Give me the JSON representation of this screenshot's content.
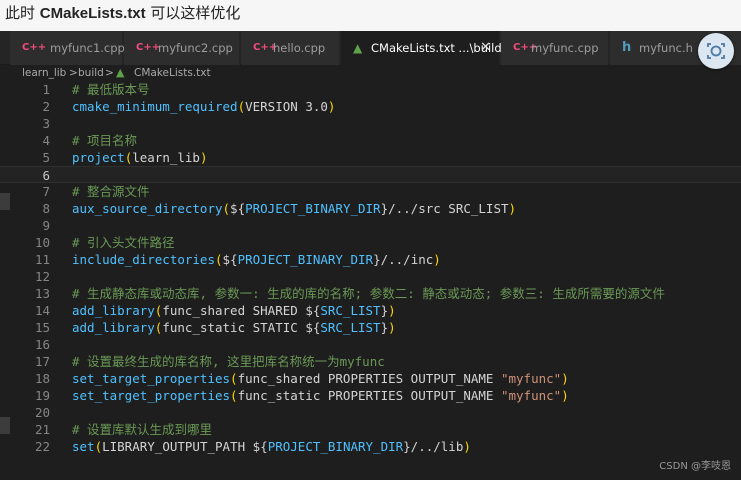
{
  "caption": {
    "prefix": "此时 ",
    "file": "CMakeLists.txt",
    "suffix": " 可以这样优化"
  },
  "tabs": [
    {
      "icon": "C++",
      "label": "myfunc1.cpp",
      "color": "#f34b7d"
    },
    {
      "icon": "C++",
      "label": "myfunc2.cpp",
      "color": "#f34b7d"
    },
    {
      "icon": "C++",
      "label": "hello.cpp",
      "color": "#f34b7d"
    },
    {
      "icon": "▲",
      "label": "CMakeLists.txt  ...\\build",
      "color": "#5ea34a",
      "active": true,
      "close": "✕"
    },
    {
      "icon": "C++",
      "label": "myfunc.cpp",
      "color": "#f34b7d"
    },
    {
      "icon": "h",
      "label": "myfunc.h",
      "color": "#519aba"
    }
  ],
  "breadcrumb": {
    "part1": "learn_lib",
    "sep": ">",
    "part2": "build",
    "icon": "▲",
    "part3": "CMakeLists.txt"
  },
  "editor": {
    "current_line": 6,
    "lines": [
      {
        "n": "1",
        "tokens": [
          [
            "c-comment",
            "# 最低版本号"
          ]
        ]
      },
      {
        "n": "2",
        "tokens": [
          [
            "c-fn",
            "cmake_minimum_required"
          ],
          [
            "c-paren",
            "("
          ],
          [
            "c-arg",
            "VERSION 3.0"
          ],
          [
            "c-paren",
            ")"
          ]
        ]
      },
      {
        "n": "3",
        "tokens": []
      },
      {
        "n": "4",
        "tokens": [
          [
            "c-comment",
            "# 项目名称"
          ]
        ]
      },
      {
        "n": "5",
        "tokens": [
          [
            "c-fn",
            "project"
          ],
          [
            "c-paren",
            "("
          ],
          [
            "c-arg",
            "learn_lib"
          ],
          [
            "c-paren",
            ")"
          ]
        ]
      },
      {
        "n": "6",
        "tokens": []
      },
      {
        "n": "7",
        "tokens": [
          [
            "c-comment",
            "# 整合源文件"
          ]
        ]
      },
      {
        "n": "8",
        "tokens": [
          [
            "c-fn",
            "aux_source_directory"
          ],
          [
            "c-paren",
            "("
          ],
          [
            "c-arg",
            "${"
          ],
          [
            "c-var",
            "PROJECT_BINARY_DIR"
          ],
          [
            "c-arg",
            "}/../src SRC_LIST"
          ],
          [
            "c-paren",
            ")"
          ]
        ]
      },
      {
        "n": "9",
        "tokens": []
      },
      {
        "n": "10",
        "tokens": [
          [
            "c-comment",
            "# 引入头文件路径"
          ]
        ]
      },
      {
        "n": "11",
        "tokens": [
          [
            "c-fn",
            "include_directories"
          ],
          [
            "c-paren",
            "("
          ],
          [
            "c-arg",
            "${"
          ],
          [
            "c-var",
            "PROJECT_BINARY_DIR"
          ],
          [
            "c-arg",
            "}/../inc"
          ],
          [
            "c-paren",
            ")"
          ]
        ]
      },
      {
        "n": "12",
        "tokens": []
      },
      {
        "n": "13",
        "tokens": [
          [
            "c-comment",
            "# 生成静态库或动态库, 参数一: 生成的库的名称; 参数二: 静态或动态; 参数三: 生成所需要的源文件"
          ]
        ]
      },
      {
        "n": "14",
        "tokens": [
          [
            "c-fn",
            "add_library"
          ],
          [
            "c-paren",
            "("
          ],
          [
            "c-arg",
            "func_shared SHARED ${"
          ],
          [
            "c-var",
            "SRC_LIST"
          ],
          [
            "c-arg",
            "}"
          ],
          [
            "c-paren",
            ")"
          ]
        ]
      },
      {
        "n": "15",
        "tokens": [
          [
            "c-fn",
            "add_library"
          ],
          [
            "c-paren",
            "("
          ],
          [
            "c-arg",
            "func_static STATIC ${"
          ],
          [
            "c-var",
            "SRC_LIST"
          ],
          [
            "c-arg",
            "}"
          ],
          [
            "c-paren",
            ")"
          ]
        ]
      },
      {
        "n": "16",
        "tokens": []
      },
      {
        "n": "17",
        "tokens": [
          [
            "c-comment",
            "# 设置最终生成的库名称, 这里把库名称统一为myfunc"
          ]
        ]
      },
      {
        "n": "18",
        "tokens": [
          [
            "c-fn",
            "set_target_properties"
          ],
          [
            "c-paren",
            "("
          ],
          [
            "c-arg",
            "func_shared PROPERTIES OUTPUT_NAME "
          ],
          [
            "c-str",
            "\"myfunc\""
          ],
          [
            "c-paren",
            ")"
          ]
        ]
      },
      {
        "n": "19",
        "tokens": [
          [
            "c-fn",
            "set_target_properties"
          ],
          [
            "c-paren",
            "("
          ],
          [
            "c-arg",
            "func_static PROPERTIES OUTPUT_NAME "
          ],
          [
            "c-str",
            "\"myfunc\""
          ],
          [
            "c-paren",
            ")"
          ]
        ]
      },
      {
        "n": "20",
        "tokens": []
      },
      {
        "n": "21",
        "tokens": [
          [
            "c-comment",
            "# 设置库默认生成到哪里"
          ]
        ]
      },
      {
        "n": "22",
        "tokens": [
          [
            "c-fn",
            "set"
          ],
          [
            "c-paren",
            "("
          ],
          [
            "c-arg",
            "LIBRARY_OUTPUT_PATH ${"
          ],
          [
            "c-var",
            "PROJECT_BINARY_DIR"
          ],
          [
            "c-arg",
            "}/../lib"
          ],
          [
            "c-paren",
            ")"
          ]
        ]
      }
    ]
  },
  "watermark": "CSDN @李吱恩"
}
